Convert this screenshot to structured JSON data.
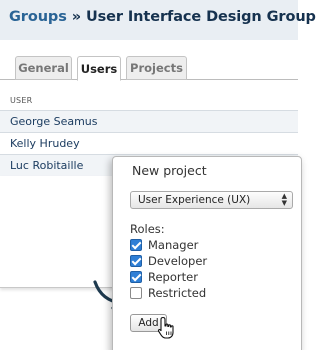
{
  "header": {
    "crumb": "Groups",
    "separator": "»",
    "title": "User Interface Design Group"
  },
  "tabs": [
    {
      "label": "General",
      "active": false
    },
    {
      "label": "Users",
      "active": true
    },
    {
      "label": "Projects",
      "active": false
    }
  ],
  "users_table": {
    "column_header": "USER",
    "rows": [
      "George Seamus",
      "Kelly Hrudey",
      "Luc Robitaille"
    ]
  },
  "popup": {
    "title": "New project",
    "project_select": {
      "selected": "User Experience (UX)"
    },
    "roles_label": "Roles:",
    "roles": [
      {
        "label": "Manager",
        "checked": true
      },
      {
        "label": "Developer",
        "checked": true
      },
      {
        "label": "Reporter",
        "checked": true
      },
      {
        "label": "Restricted",
        "checked": false
      }
    ],
    "add_label": "Add"
  },
  "colors": {
    "header_bg": "#e9eef3",
    "title_text": "#16324f",
    "checkbox_checked": "#2f7fd6",
    "callout_arrow": "#1e3a4f"
  },
  "icons": {
    "cursor": "hand-pointer-icon",
    "callout": "curved-arrow-icon",
    "select": "select-arrows-icon"
  }
}
